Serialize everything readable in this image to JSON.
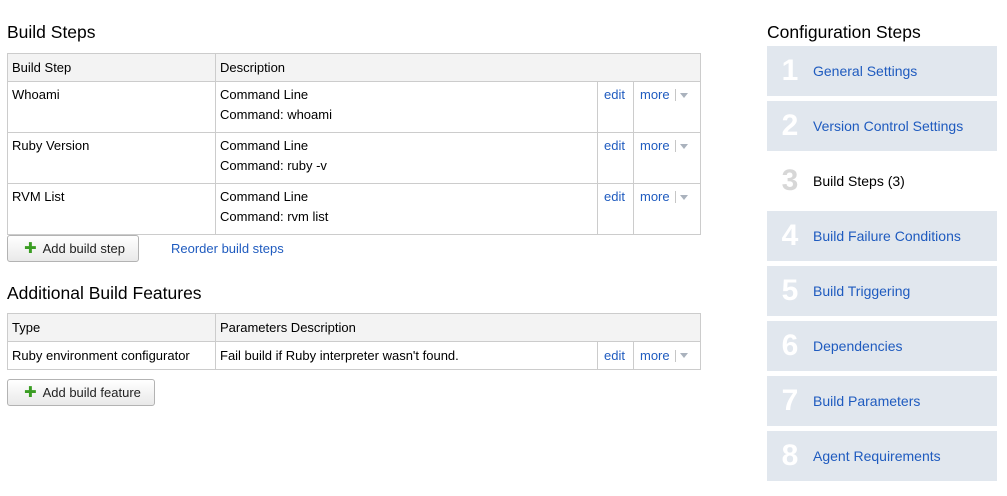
{
  "build_steps": {
    "title": "Build Steps",
    "columns": [
      "Build Step",
      "Description"
    ],
    "rows": [
      {
        "name": "Whoami",
        "type": "Command Line",
        "command": "Command: whoami",
        "edit": "edit",
        "more": "more"
      },
      {
        "name": "Ruby Version",
        "type": "Command Line",
        "command": "Command: ruby -v",
        "edit": "edit",
        "more": "more"
      },
      {
        "name": "RVM List",
        "type": "Command Line",
        "command": "Command: rvm list",
        "edit": "edit",
        "more": "more"
      }
    ],
    "add_button": "Add build step",
    "reorder_link": "Reorder build steps"
  },
  "features": {
    "title": "Additional Build Features",
    "columns": [
      "Type",
      "Parameters Description"
    ],
    "rows": [
      {
        "type": "Ruby environment configurator",
        "description": "Fail build if Ruby interpreter wasn't found.",
        "edit": "edit",
        "more": "more"
      }
    ],
    "add_button": "Add build feature"
  },
  "config_steps": {
    "title": "Configuration Steps",
    "items": [
      {
        "num": "1",
        "label": "General Settings",
        "active": false
      },
      {
        "num": "2",
        "label": "Version Control Settings",
        "active": false
      },
      {
        "num": "3",
        "label": "Build Steps (3)",
        "active": true
      },
      {
        "num": "4",
        "label": "Build Failure Conditions",
        "active": false
      },
      {
        "num": "5",
        "label": "Build Triggering",
        "active": false
      },
      {
        "num": "6",
        "label": "Dependencies",
        "active": false
      },
      {
        "num": "7",
        "label": "Build Parameters",
        "active": false
      },
      {
        "num": "8",
        "label": "Agent Requirements",
        "active": false
      }
    ]
  },
  "colors": {
    "link": "#1f5bbf",
    "step_bg": "#e1e7ee",
    "plus": "#3a9d23"
  }
}
